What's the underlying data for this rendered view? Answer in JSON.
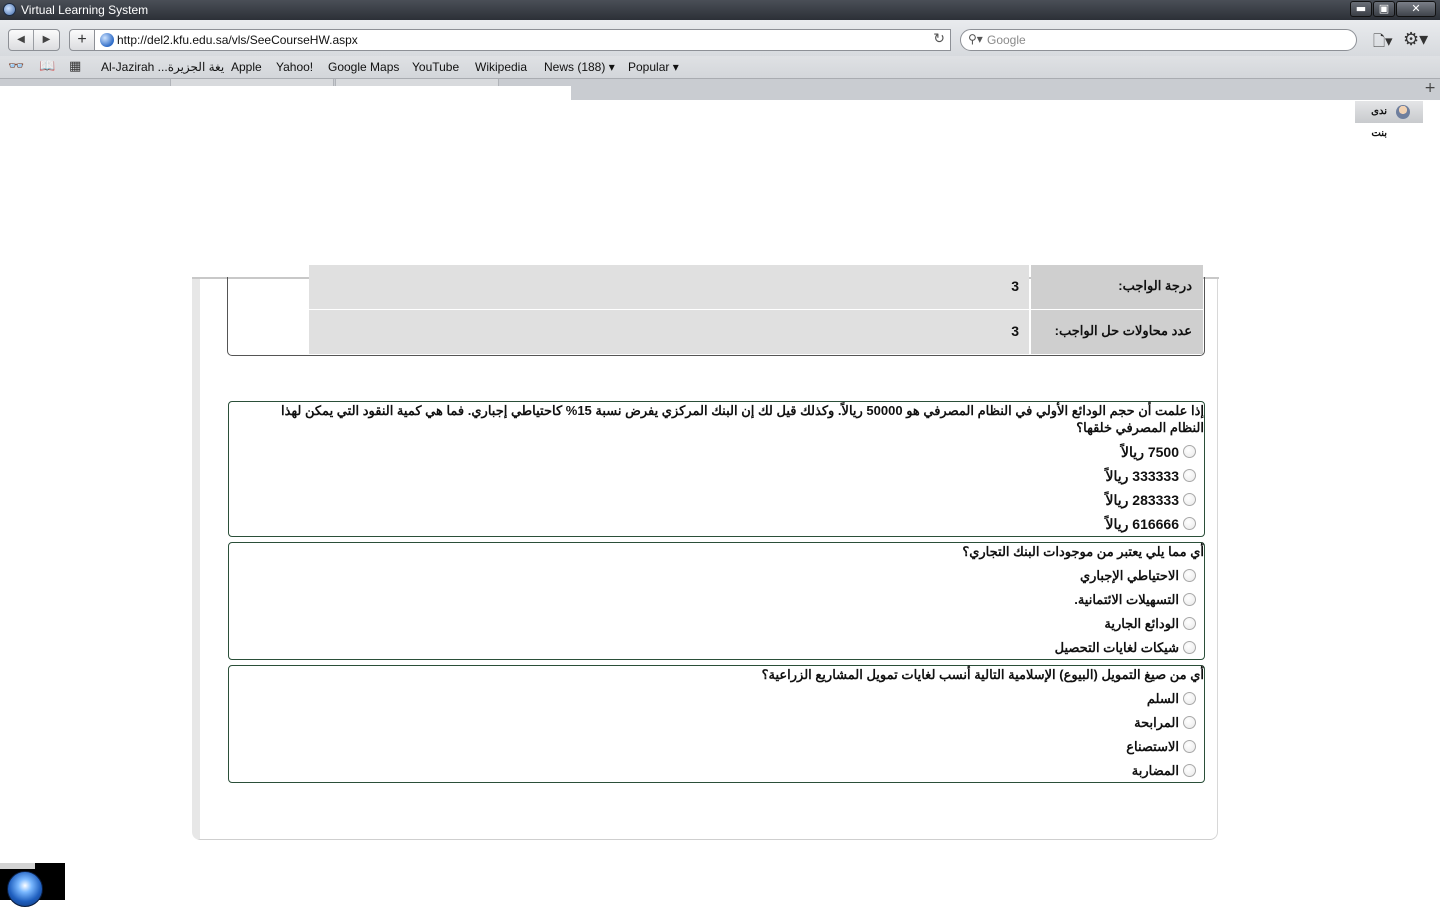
{
  "window": {
    "title": "Virtual Learning System",
    "buttons": {
      "minimize": "▬",
      "maximize": "▣",
      "close": "✕"
    }
  },
  "toolbar": {
    "back": "◀",
    "forward": "▶",
    "add": "+",
    "url": "http://del2.kfu.edu.sa/vls/SeeCourseHW.aspx",
    "reload": "↻",
    "search_placeholder": "Google",
    "search_glyph": "⚲▾",
    "page_menu": "🗋▾",
    "gear": "⚙▾"
  },
  "bookmarks": {
    "icons": {
      "glasses": "👓",
      "book": "📖",
      "grid": "▦"
    },
    "items": [
      "Al-Jazirah ...يغة الجزيرة",
      "Apple",
      "Yahoo!",
      "Google Maps",
      "YouTube",
      "Wikipedia",
      "News (188) ▾",
      "Popular ▾"
    ]
  },
  "tabstrip": {
    "add": "+"
  },
  "user": {
    "name": "ندى بنت"
  },
  "homework_info": [
    {
      "label": "درجة الواجب:",
      "value": "3"
    },
    {
      "label": "عدد محاولات حل الواجب:",
      "value": "3"
    }
  ],
  "questions": [
    {
      "text": "إذا علمت أن حجم الودائع الأولي في النظام المصرفي هو 50000 ريالاً. وكذلك قيل لك إن البنك المركزي يفرض نسبة 15% كاحتياطي إجباري. فما هي كمية النقود التي يمكن لهذا النظام المصرفي خلقها؟",
      "options": [
        "7500 ريالاً",
        "333333 ريالاً",
        "283333 ريالاً",
        "616666 ريالاً"
      ]
    },
    {
      "text": "أي مما يلي يعتبر من موجودات البنك التجاري؟",
      "options": [
        "الاحتياطي الإجباري",
        "التسهيلات الائتمانية.",
        "الودائع الجارية",
        "شيكات لغايات التحصيل"
      ]
    },
    {
      "text": "أي من صيغ التمويل (البيوع) الإسلامية التالية أنسب لغايات تمويل المشاريع الزراعية؟",
      "options": [
        "السلم",
        "المرابحة",
        "الاستصناع",
        "المضاربة"
      ]
    }
  ]
}
